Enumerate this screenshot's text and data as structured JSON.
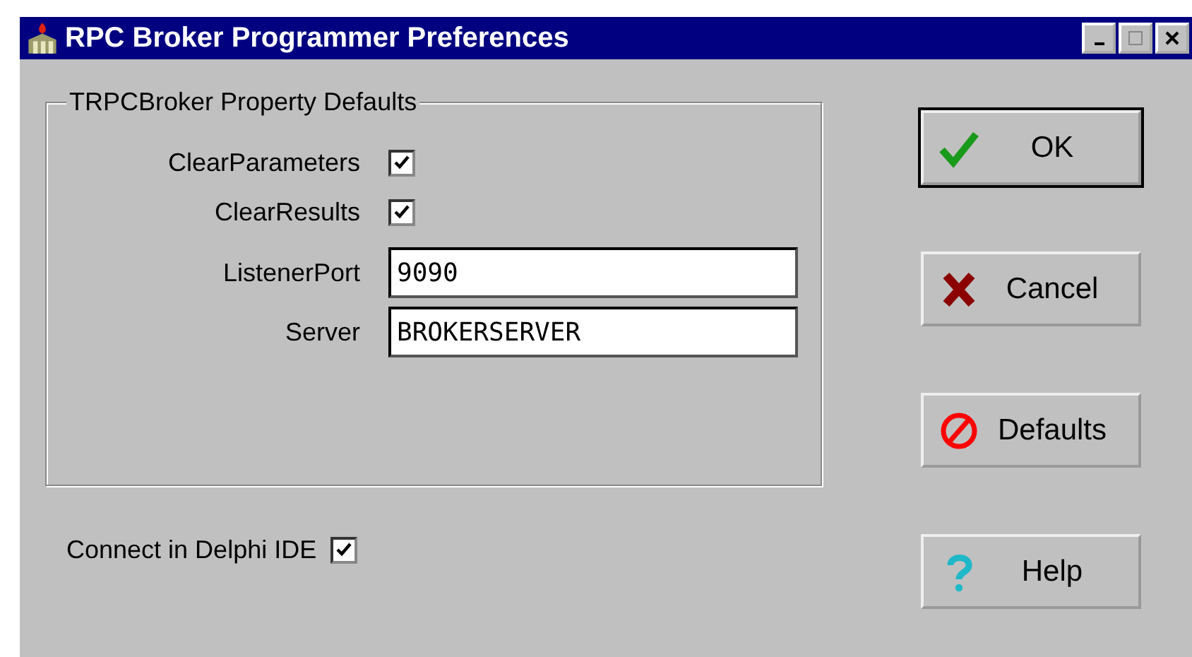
{
  "window": {
    "title": "RPC Broker Programmer Preferences"
  },
  "group": {
    "title": "TRPCBroker Property Defaults",
    "rows": [
      {
        "kind": "checkbox",
        "label": "ClearParameters",
        "checked": true
      },
      {
        "kind": "checkbox",
        "label": "ClearResults",
        "checked": true
      },
      {
        "kind": "field",
        "label": "ListenerPort",
        "value": "9090"
      },
      {
        "kind": "field",
        "label": "Server",
        "value": "BROKERSERVER"
      }
    ]
  },
  "connect": {
    "label": "Connect in Delphi IDE",
    "checked": true
  },
  "buttons": [
    {
      "label": "OK",
      "kind": "ok",
      "default": true
    },
    {
      "label": "Cancel",
      "kind": "cancel",
      "default": false
    },
    {
      "label": "Defaults",
      "kind": "defaults",
      "default": false
    },
    {
      "label": "Help",
      "kind": "help",
      "default": false
    }
  ]
}
